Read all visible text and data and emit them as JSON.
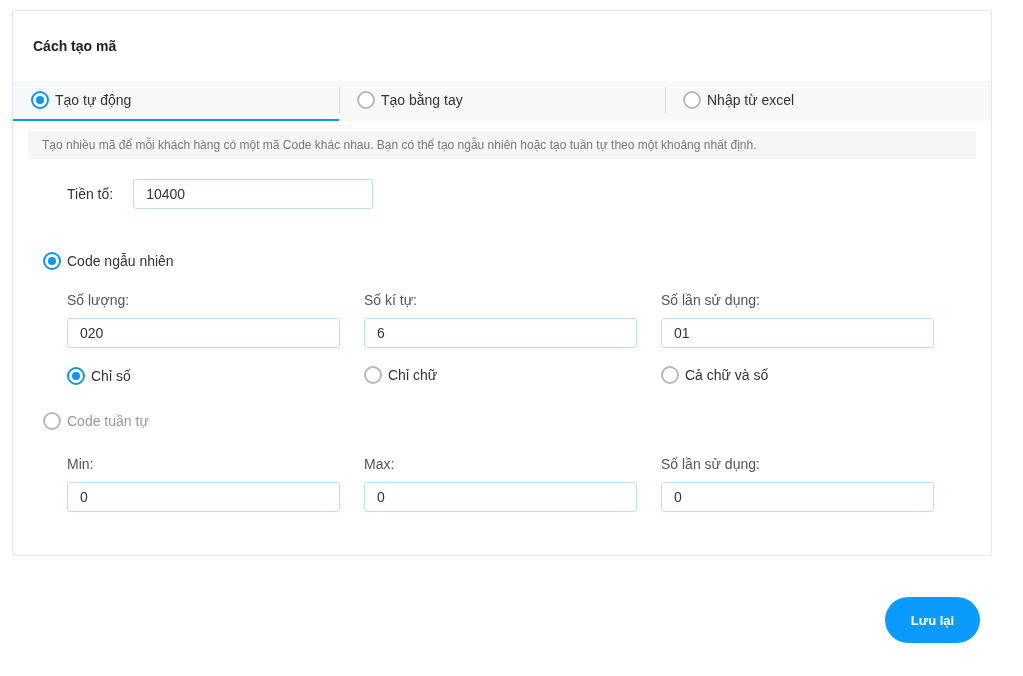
{
  "card": {
    "title": "Cách tạo mã"
  },
  "tabs": [
    {
      "label": "Tạo tự động",
      "selected": true
    },
    {
      "label": "Tạo bằng tay",
      "selected": false
    },
    {
      "label": "Nhập từ excel",
      "selected": false
    }
  ],
  "description": "Tạo nhiều mã để mỗi khách hàng có một mã Code khác nhau. Bạn có thể tạo ngẫu nhiên hoặc tạo tuần tự theo một khoảng nhất định.",
  "prefix": {
    "label": "Tiền tố:",
    "value": "10400"
  },
  "modes": [
    {
      "label": "Code ngẫu nhiên",
      "selected": true,
      "fields": [
        {
          "label": "Số lượng:",
          "value": "020"
        },
        {
          "label": "Số kí tự:",
          "value": "6"
        },
        {
          "label": "Số lần sử dụng:",
          "value": "01"
        }
      ],
      "options": [
        {
          "label": "Chỉ số",
          "selected": true
        },
        {
          "label": "Chỉ chữ",
          "selected": false
        },
        {
          "label": "Cả chữ và số",
          "selected": false
        }
      ]
    },
    {
      "label": "Code tuần tự",
      "selected": false,
      "fields": [
        {
          "label": "Min:",
          "value": "0"
        },
        {
          "label": "Max:",
          "value": "0"
        },
        {
          "label": "Số lần sử dụng:",
          "value": "0"
        }
      ]
    }
  ],
  "save_button": "Lưu lại"
}
